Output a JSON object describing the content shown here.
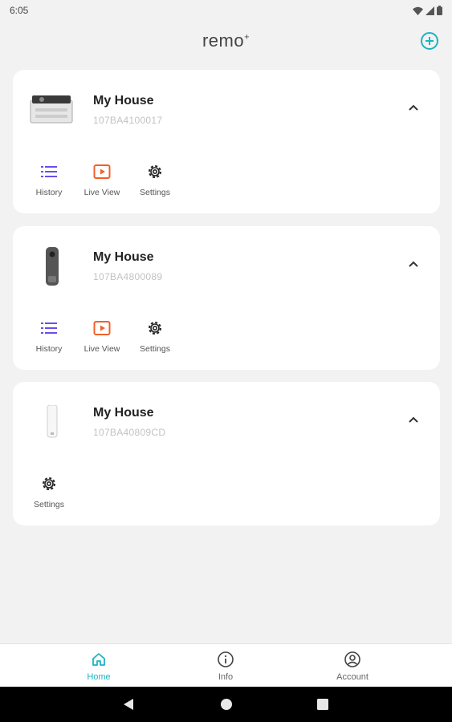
{
  "status_bar": {
    "time": "6:05"
  },
  "app_bar": {
    "logo": "remo",
    "logo_sup": "+"
  },
  "colors": {
    "accent": "#1ab5c3",
    "history_icon": "#6a4ee8",
    "live_icon": "#f2602a",
    "card_bg": "#ffffff",
    "page_bg": "#f2f2f2"
  },
  "devices": [
    {
      "name": "My House",
      "serial": "107BA4100017",
      "image": "camera-bar-device",
      "actions": [
        {
          "label": "History",
          "icon": "history-list-icon"
        },
        {
          "label": "Live View",
          "icon": "play-icon"
        },
        {
          "label": "Settings",
          "icon": "gear-icon"
        }
      ]
    },
    {
      "name": "My House",
      "serial": "107BA4800089",
      "image": "video-doorbell-device",
      "actions": [
        {
          "label": "History",
          "icon": "history-list-icon"
        },
        {
          "label": "Live View",
          "icon": "play-icon"
        },
        {
          "label": "Settings",
          "icon": "gear-icon"
        }
      ]
    },
    {
      "name": "My House",
      "serial": "107BA40809CD",
      "image": "door-sensor-device",
      "actions": [
        {
          "label": "Settings",
          "icon": "gear-icon"
        }
      ]
    }
  ],
  "bottom_nav": [
    {
      "label": "Home",
      "icon": "home-icon",
      "active": true
    },
    {
      "label": "Info",
      "icon": "info-icon",
      "active": false
    },
    {
      "label": "Account",
      "icon": "account-icon",
      "active": false
    }
  ]
}
